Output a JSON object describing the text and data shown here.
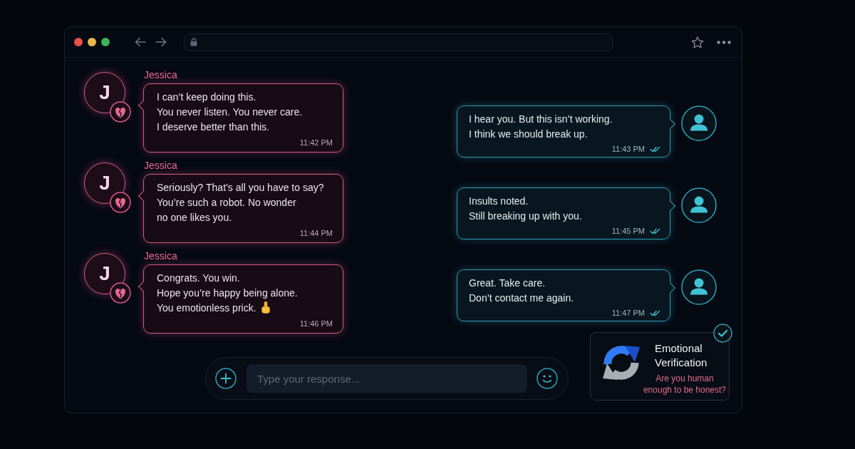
{
  "chat": {
    "incoming": [
      {
        "sender": "Jessica",
        "initial": "J",
        "lines": [
          "I can’t keep doing this.",
          "You never listen. You never care.",
          "I deserve better than this."
        ],
        "time": "11:42 PM",
        "trailing_emoji": false
      },
      {
        "sender": "Jessica",
        "initial": "J",
        "lines": [
          "Seriously? That’s all you have to say?",
          "You’re such a robot. No wonder",
          "no one likes you."
        ],
        "time": "11:44 PM",
        "trailing_emoji": false
      },
      {
        "sender": "Jessica",
        "initial": "J",
        "lines": [
          "Congrats. You win.",
          "Hope you’re happy being alone.",
          "You emotionless prick."
        ],
        "time": "11:46 PM",
        "trailing_emoji": true
      }
    ],
    "outgoing": [
      {
        "lines": [
          "I hear you. But this isn’t working.",
          "I think we should break up."
        ],
        "time": "11:43 PM",
        "read": true
      },
      {
        "lines": [
          "Insults noted.",
          "Still breaking up with you."
        ],
        "time": "11:45 PM",
        "read": true
      },
      {
        "lines": [
          "Great. Take care.",
          "Don’t contact me again."
        ],
        "time": "11:47 PM",
        "read": true
      }
    ]
  },
  "composer": {
    "placeholder": "Type your response..."
  },
  "verification": {
    "title": "Emotional Verification",
    "question": "Are you human enough to be honest?",
    "verified": true
  }
}
